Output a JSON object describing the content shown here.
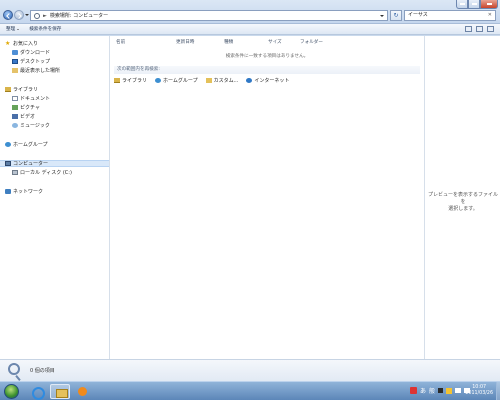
{
  "window": {
    "address_path": "検索場所: コンピューター",
    "address_arrow": "►",
    "search_value": "イーサス",
    "search_clear": "✕",
    "refresh_glyph": "↻"
  },
  "toolbar": {
    "organize_label": "整理",
    "save_search_label": "検索条件を保存"
  },
  "nav": {
    "favorites": "お気に入り",
    "downloads": "ダウンロード",
    "desktop": "デスクトップ",
    "recent": "最近表示した場所",
    "libraries": "ライブラリ",
    "documents": "ドキュメント",
    "pictures": "ピクチャ",
    "videos": "ビデオ",
    "music": "ミュージック",
    "homegroup": "ホームグループ",
    "computer": "コンピューター",
    "local_disk": "ローカル ディスク (C:)",
    "network": "ネットワーク"
  },
  "content": {
    "columns": [
      "名前",
      "更新日時",
      "種類",
      "サイズ",
      "フォルダー"
    ],
    "empty_message": "検索条件に一致する項目はありません。",
    "search_again_label": "次の範囲内を再検索:",
    "search_locations": [
      "ライブラリ",
      "ホームグループ",
      "カスタム...",
      "インターネット"
    ]
  },
  "preview": {
    "line1": "プレビューを表示するファイルを",
    "line2": "選択します。"
  },
  "details": {
    "item_count": "0 個の項目"
  },
  "taskbar": {
    "tray_char1": "あ",
    "tray_char2": "般",
    "clock_time": "10:07",
    "clock_date": "2011/03/26"
  }
}
